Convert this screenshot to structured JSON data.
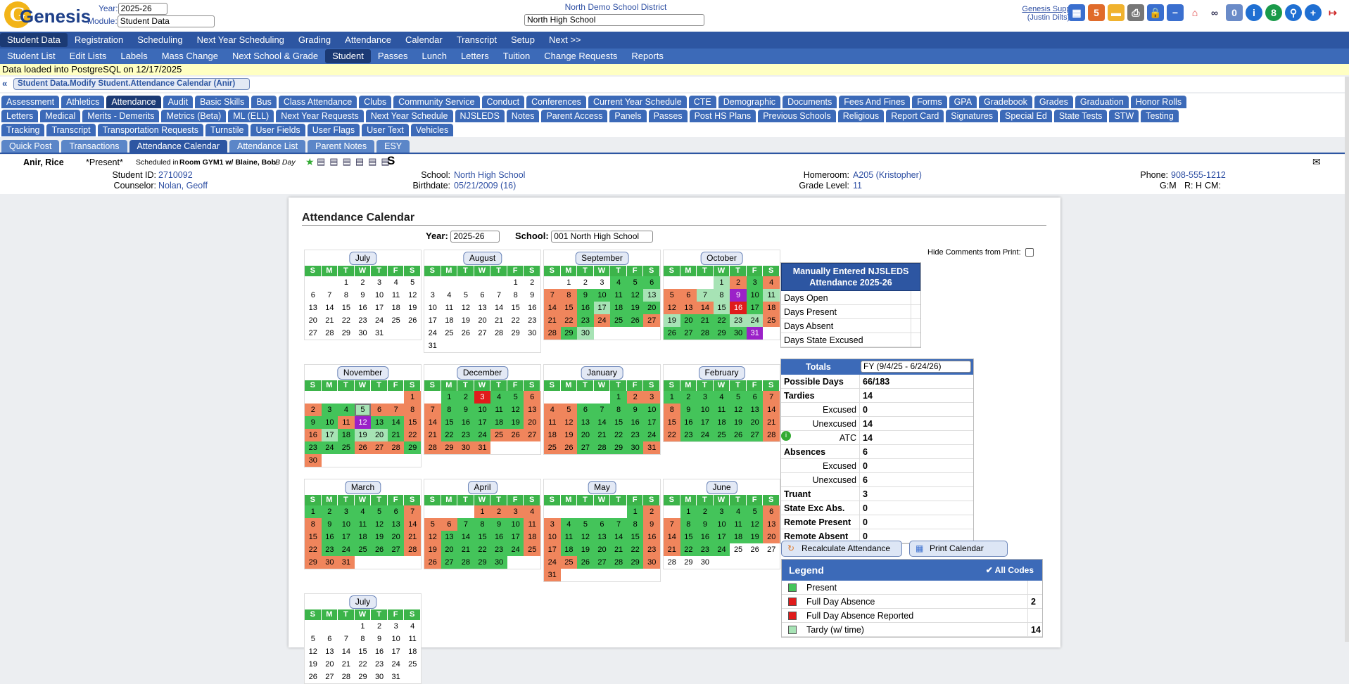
{
  "header": {
    "logo": "Genesis",
    "logo_initial": "G",
    "year_label": "Year:",
    "year_value": "2025-26",
    "module_label": "Module:",
    "module_value": "Student Data",
    "district": "North Demo School District",
    "school": "North High School",
    "user_name": "Genesis Suppo",
    "user_sub": "(Justin Dilts)",
    "mail_count": "0",
    "help_count": "8"
  },
  "nav1": [
    "Student Data",
    "Registration",
    "Scheduling",
    "Next Year Scheduling",
    "Grading",
    "Attendance",
    "Calendar",
    "Transcript",
    "Setup",
    "Next >>"
  ],
  "nav2": [
    "Student List",
    "Edit Lists",
    "Labels",
    "Mass Change",
    "Next School & Grade",
    "Student",
    "Passes",
    "Lunch",
    "Letters",
    "Tuition",
    "Change Requests",
    "Reports"
  ],
  "loaded": "Data loaded into PostgreSQL on 12/17/2025",
  "breadcrumb": "Student Data.Modify Student.Attendance Calendar (Anir)",
  "tabs_row1": [
    "Assessment",
    "Athletics",
    "Attendance",
    "Audit",
    "Basic Skills",
    "Bus",
    "Class Attendance",
    "Clubs",
    "Community Service",
    "Conduct",
    "Conferences",
    "Current Year Schedule",
    "CTE",
    "Demographic",
    "Documents",
    "Fees And Fines",
    "Forms",
    "GPA",
    "Gradebook",
    "Grades",
    "Graduation",
    "Honor Rolls"
  ],
  "tabs_row2": [
    "Letters",
    "Medical",
    "Merits - Demerits",
    "Metrics (Beta)",
    "ML (ELL)",
    "Next Year Requests",
    "Next Year Schedule",
    "NJSLEDS",
    "Notes",
    "Parent Access",
    "Panels",
    "Passes",
    "Post HS Plans",
    "Previous Schools",
    "Religious",
    "Report Card",
    "Signatures",
    "Special Ed",
    "State Tests",
    "STW",
    "Testing"
  ],
  "tabs_row3": [
    "Tracking",
    "Transcript",
    "Transportation Requests",
    "Turnstile",
    "User Fields",
    "User Flags",
    "User Text",
    "Vehicles"
  ],
  "subtabs": [
    "Quick Post",
    "Transactions",
    "Attendance Calendar",
    "Attendance List",
    "Parent Notes",
    "ESY"
  ],
  "student": {
    "name": "Anir, Rice",
    "status": "*Present*",
    "sched_pre": "Scheduled in",
    "room": "Room GYM1 w/ Blaine, Bob",
    "day": "B Day",
    "id_label": "Student ID:",
    "id": "2710092",
    "counselor_label": "Counselor:",
    "counselor": "Nolan, Geoff",
    "school_label": "School:",
    "school": "North High School",
    "birth_label": "Birthdate:",
    "birth": "05/21/2009 (16)",
    "hr_label": "Homeroom:",
    "hr": "A205 (Kristopher)",
    "grade_label": "Grade Level:",
    "grade": "11",
    "phone_label": "Phone:",
    "phone": "908-555-1212",
    "gm": "G:M",
    "r": "R: H",
    "cm": "CM:"
  },
  "calendar": {
    "title": "Attendance Calendar",
    "year_label": "Year:",
    "year": "2025-26",
    "school_label": "School:",
    "school": "001 North High School",
    "hide_label": "Hide Comments from Print:"
  },
  "manual": {
    "title": "Manually Entered NJSLEDS Attendance 2025-26",
    "rows": [
      "Days Open",
      "Days Present",
      "Days Absent",
      "Days State Excused"
    ]
  },
  "totals": {
    "title": "Totals",
    "period": "FY (9/4/25 - 6/24/26)",
    "rows": [
      [
        "Possible Days",
        "66/183"
      ],
      [
        "Tardies",
        "14"
      ],
      [
        "Excused",
        "0"
      ],
      [
        "Unexcused",
        "14"
      ],
      [
        "ATC",
        "14"
      ],
      [
        "Absences",
        "6"
      ],
      [
        "Excused",
        "0"
      ],
      [
        "Unexcused",
        "6"
      ],
      [
        "Truant",
        "3"
      ],
      [
        "State Exc Abs.",
        "0"
      ],
      [
        "Remote Present",
        "0"
      ],
      [
        "Remote Absent",
        "0"
      ]
    ]
  },
  "buttons": {
    "recalc": "Recalculate Attendance",
    "print": "Print Calendar"
  },
  "legend": {
    "title": "Legend",
    "all_codes": "All Codes",
    "rows": [
      [
        "Present",
        "",
        "#44c45a"
      ],
      [
        "Full Day Absence",
        "2",
        "#e01b1b"
      ],
      [
        "Full Day Absence Reported",
        "",
        "#e01b1b"
      ],
      [
        "Tardy (w/ time)",
        "14",
        "#a7e3b5"
      ]
    ]
  },
  "weekdays": [
    "S",
    "M",
    "T",
    "W",
    "T",
    "F",
    "S"
  ],
  "months": [
    {
      "name": "July",
      "start": 2,
      "days": 31,
      "codes": ""
    },
    {
      "name": "August",
      "start": 5,
      "days": 31,
      "codes": ""
    },
    {
      "name": "September",
      "start": 1,
      "days": 30,
      "codes": "XXXPPPAAPPPPTAAPTPPPAAPAPPAAPTP"
    },
    {
      "name": "October",
      "start": 3,
      "days": 31,
      "codes": "TAPAAATTVPTAAATRPATPPPTTAPPPPPV"
    },
    {
      "name": "November",
      "start": 6,
      "days": 30,
      "codes": "AAPPSAAAPPAVPPAATPTTPAPPPAAAPA"
    },
    {
      "name": "December",
      "start": 1,
      "days": 31,
      "codes": "PPRPPAAPPPPPAAPPPPPAAPPPAAAAAAA"
    },
    {
      "name": "January",
      "start": 4,
      "days": 31,
      "codes": "PAAAAPPPPPAAPPPPPAAPPPPPAAPPPPA"
    },
    {
      "name": "February",
      "start": 0,
      "days": 28,
      "codes": "PPPPPPAAPPPPPAAPPPPPAAPPPPPA"
    },
    {
      "name": "March",
      "start": 0,
      "days": 31,
      "codes": "PPPPPPAAPPPPPAAPPPPPAAPPPPPAAAA"
    },
    {
      "name": "April",
      "start": 3,
      "days": 30,
      "codes": "AAAAAAPPPPAAPPPPPAAPPPPPAAPPPP"
    },
    {
      "name": "May",
      "start": 5,
      "days": 31,
      "codes": "PAAPPPPPAAPPPPPAAPPPPPAAAPPPPAA"
    },
    {
      "name": "June",
      "start": 1,
      "days": 30,
      "codes": "PPPPPAAPPPPPAAPPPPPAAPPPXXXXXX"
    },
    {
      "name": "July",
      "start": 3,
      "days": 31,
      "codes": ""
    }
  ]
}
